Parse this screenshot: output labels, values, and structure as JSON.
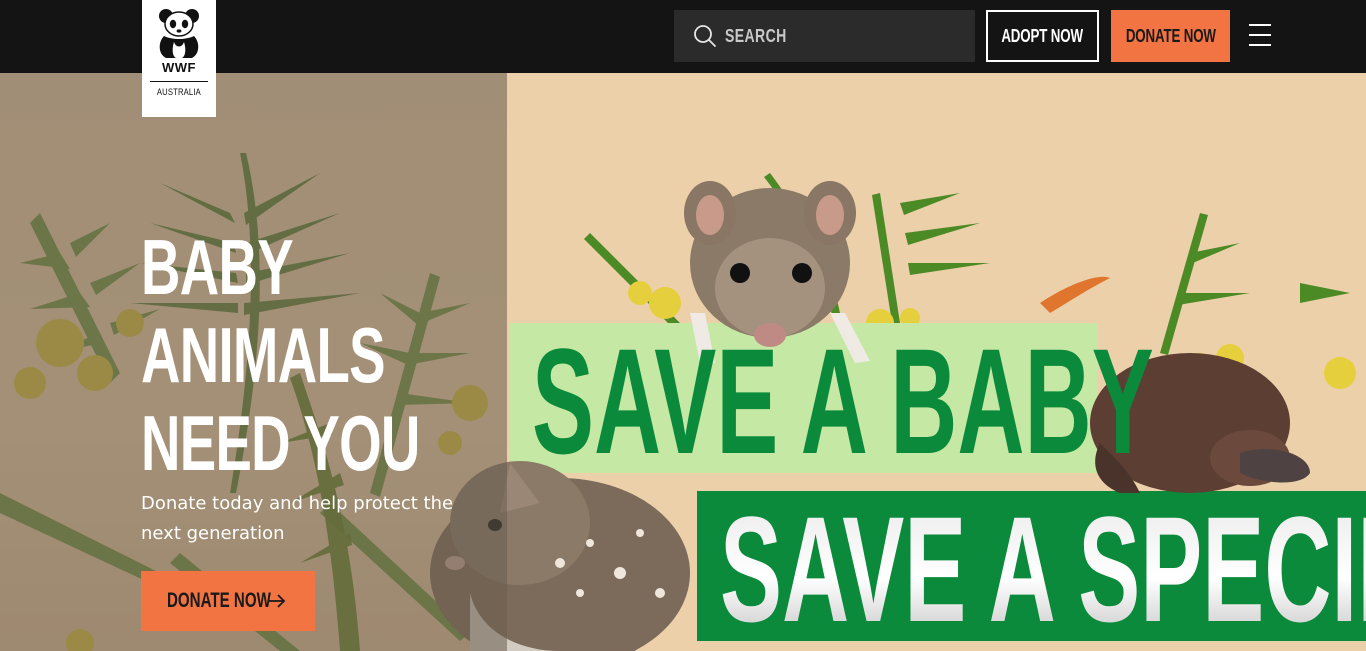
{
  "header": {
    "logo": {
      "brand": "WWF",
      "country": "AUSTRALIA"
    },
    "search": {
      "placeholder": "SEARCH",
      "icon": "search-icon"
    },
    "adopt_label": "ADOPT NOW",
    "donate_label": "DONATE NOW",
    "menu_icon": "hamburger-icon"
  },
  "hero": {
    "headline": [
      "BABY",
      "ANIMALS",
      "NEED YOU"
    ],
    "subtext": "Donate today and help protect the next generation",
    "cta_label": "DONATE NOW",
    "cta_icon": "arrow-right-icon",
    "banner": {
      "line1": "SAVE A BABY",
      "line2": "SAVE A SPECIES"
    }
  },
  "colors": {
    "header_bg": "#141414",
    "accent": "#f37443",
    "banner_green": "#0a8a3a",
    "banner_light_green": "#c5e8a4"
  }
}
